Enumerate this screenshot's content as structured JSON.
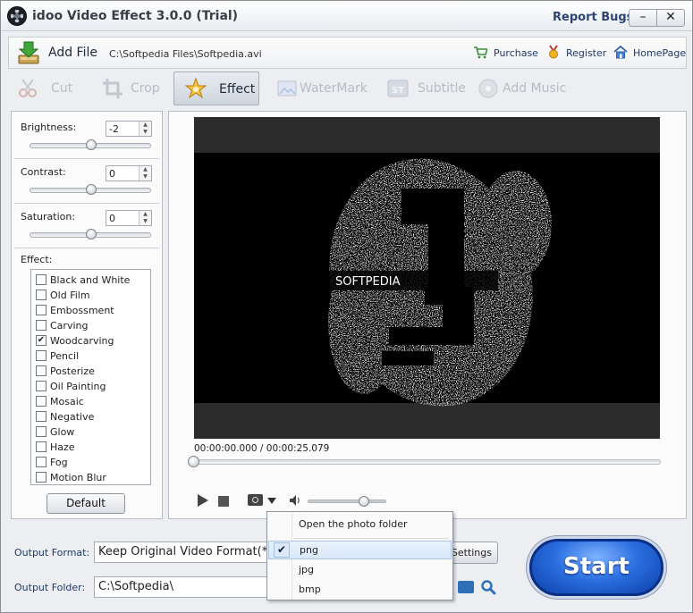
{
  "window": {
    "title": "idoo Video Effect 3.0.0 (Trial)",
    "report_bugs": "Report Bugs",
    "minimize": "–",
    "close": "✕"
  },
  "filebar": {
    "add_file": "Add File",
    "file_path": "C:\\Softpedia Files\\Softpedia.avi",
    "purchase": "Purchase",
    "register": "Register",
    "homepage": "HomePage"
  },
  "tools": [
    {
      "label": "Cut",
      "icon": "scissors-icon"
    },
    {
      "label": "Crop",
      "icon": "crop-icon"
    },
    {
      "label": "Effect",
      "icon": "star-icon",
      "active": true
    },
    {
      "label": "WaterMark",
      "icon": "watermark-icon"
    },
    {
      "label": "Subtitle",
      "icon": "subtitle-icon"
    },
    {
      "label": "Add Music",
      "icon": "music-icon"
    }
  ],
  "adjust": {
    "brightness_label": "Brightness:",
    "brightness_value": "-2",
    "contrast_label": "Contrast:",
    "contrast_value": "0",
    "saturation_label": "Saturation:",
    "saturation_value": "0",
    "effect_label": "Effect:"
  },
  "effects": [
    {
      "label": "Black and White",
      "checked": false
    },
    {
      "label": "Old Film",
      "checked": false
    },
    {
      "label": "Embossment",
      "checked": false
    },
    {
      "label": "Carving",
      "checked": false
    },
    {
      "label": "Woodcarving",
      "checked": true
    },
    {
      "label": "Pencil",
      "checked": false
    },
    {
      "label": "Posterize",
      "checked": false
    },
    {
      "label": "Oil Painting",
      "checked": false
    },
    {
      "label": "Mosaic",
      "checked": false
    },
    {
      "label": "Negative",
      "checked": false
    },
    {
      "label": "Glow",
      "checked": false
    },
    {
      "label": "Haze",
      "checked": false
    },
    {
      "label": "Fog",
      "checked": false
    },
    {
      "label": "Motion Blur",
      "checked": false
    }
  ],
  "default_button": "Default",
  "player": {
    "time_current": "00:00:00.000",
    "time_separator": "/",
    "time_total": "00:00:25.079",
    "seek_fraction": 0.0,
    "volume_fraction": 0.72,
    "video_text": "SOFTPEDIA"
  },
  "bottom": {
    "output_format_label": "Output Format:",
    "output_format_value": "Keep Original Video Format(*.avi)",
    "settings": "Settings",
    "output_folder_label": "Output Folder:",
    "output_folder_value": "C:\\Softpedia\\",
    "start": "Start"
  },
  "snapshot_menu": {
    "open_folder": "Open the photo folder",
    "formats": [
      "png",
      "jpg",
      "bmp"
    ],
    "selected": "png"
  },
  "colors": {
    "start_blue": "#2b6fe0",
    "link_blue": "#1f3a68"
  }
}
